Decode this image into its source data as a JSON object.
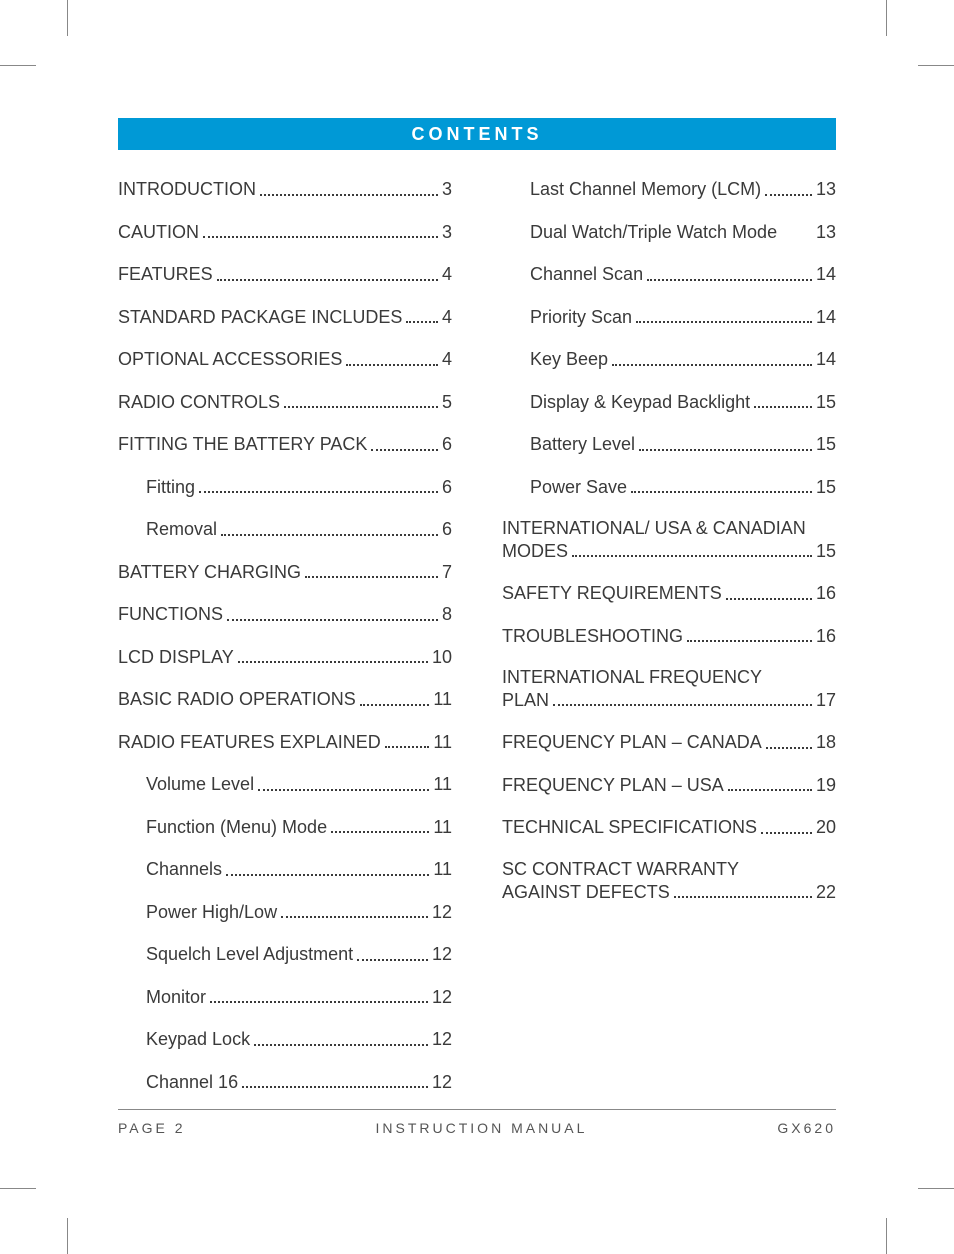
{
  "title": "CONTENTS",
  "footer": {
    "left": "PAGE 2",
    "center": "INSTRUCTION MANUAL",
    "right": "GX620"
  },
  "left_col": [
    {
      "label": "INTRODUCTION",
      "page": "3",
      "indent": 0
    },
    {
      "label": "CAUTION",
      "page": "3",
      "indent": 0
    },
    {
      "label": "FEATURES",
      "page": "4",
      "indent": 0
    },
    {
      "label": "STANDARD PACKAGE INCLUDES",
      "page": "4",
      "indent": 0
    },
    {
      "label": "OPTIONAL ACCESSORIES",
      "page": "4",
      "indent": 0
    },
    {
      "label": "RADIO CONTROLS",
      "page": "5",
      "indent": 0
    },
    {
      "label": "FITTING THE BATTERY PACK",
      "page": "6",
      "indent": 0
    },
    {
      "label": "Fitting",
      "page": "6",
      "indent": 1
    },
    {
      "label": "Removal",
      "page": "6",
      "indent": 1
    },
    {
      "label": "BATTERY CHARGING",
      "page": "7",
      "indent": 0
    },
    {
      "label": "FUNCTIONS",
      "page": "8",
      "indent": 0
    },
    {
      "label": "LCD DISPLAY",
      "page": "10",
      "indent": 0
    },
    {
      "label": "BASIC RADIO OPERATIONS",
      "page": "11",
      "indent": 0
    },
    {
      "label": "RADIO FEATURES EXPLAINED",
      "page": "11",
      "indent": 0
    },
    {
      "label": "Volume Level",
      "page": "11",
      "indent": 1
    },
    {
      "label": "Function (Menu) Mode",
      "page": "11",
      "indent": 1
    },
    {
      "label": "Channels",
      "page": "11",
      "indent": 1
    },
    {
      "label": "Power High/Low",
      "page": "12",
      "indent": 1
    },
    {
      "label": "Squelch Level Adjustment",
      "page": "12",
      "indent": 1
    },
    {
      "label": "Monitor",
      "page": "12",
      "indent": 1
    },
    {
      "label": "Keypad Lock",
      "page": "12",
      "indent": 1
    },
    {
      "label": "Channel 16",
      "page": "12",
      "indent": 1
    }
  ],
  "right_col": [
    {
      "label": "Last Channel Memory (LCM)",
      "page": "13",
      "indent": 1
    },
    {
      "label": "Dual Watch/Triple Watch Mode",
      "page": "13",
      "indent": 1,
      "tight": true
    },
    {
      "label": "Channel Scan",
      "page": "14",
      "indent": 1
    },
    {
      "label": "Priority Scan",
      "page": "14",
      "indent": 1
    },
    {
      "label": "Key Beep",
      "page": "14",
      "indent": 1
    },
    {
      "label": "Display & Keypad Backlight",
      "page": "15",
      "indent": 1
    },
    {
      "label": "Battery Level",
      "page": "15",
      "indent": 1
    },
    {
      "label": "Power Save",
      "page": "15",
      "indent": 1
    },
    {
      "label_line1": "INTERNATIONAL/ USA & CANADIAN",
      "label_line2": "MODES",
      "page": "15",
      "indent": 0,
      "multiline": true
    },
    {
      "label": "SAFETY REQUIREMENTS",
      "page": "16",
      "indent": 0
    },
    {
      "label": "TROUBLESHOOTING",
      "page": "16",
      "indent": 0
    },
    {
      "label_line1": "INTERNATIONAL FREQUENCY",
      "label_line2": "PLAN",
      "page": "17",
      "indent": 0,
      "multiline": true
    },
    {
      "label": "FREQUENCY PLAN – CANADA",
      "page": "18",
      "indent": 0
    },
    {
      "label": "FREQUENCY PLAN – USA",
      "page": "19",
      "indent": 0
    },
    {
      "label": "TECHNICAL SPECIFICATIONS",
      "page": "20",
      "indent": 0
    },
    {
      "label_line1": "SC CONTRACT WARRANTY",
      "label_line2": "AGAINST DEFECTS",
      "page": "22",
      "indent": 0,
      "multiline": true
    }
  ]
}
